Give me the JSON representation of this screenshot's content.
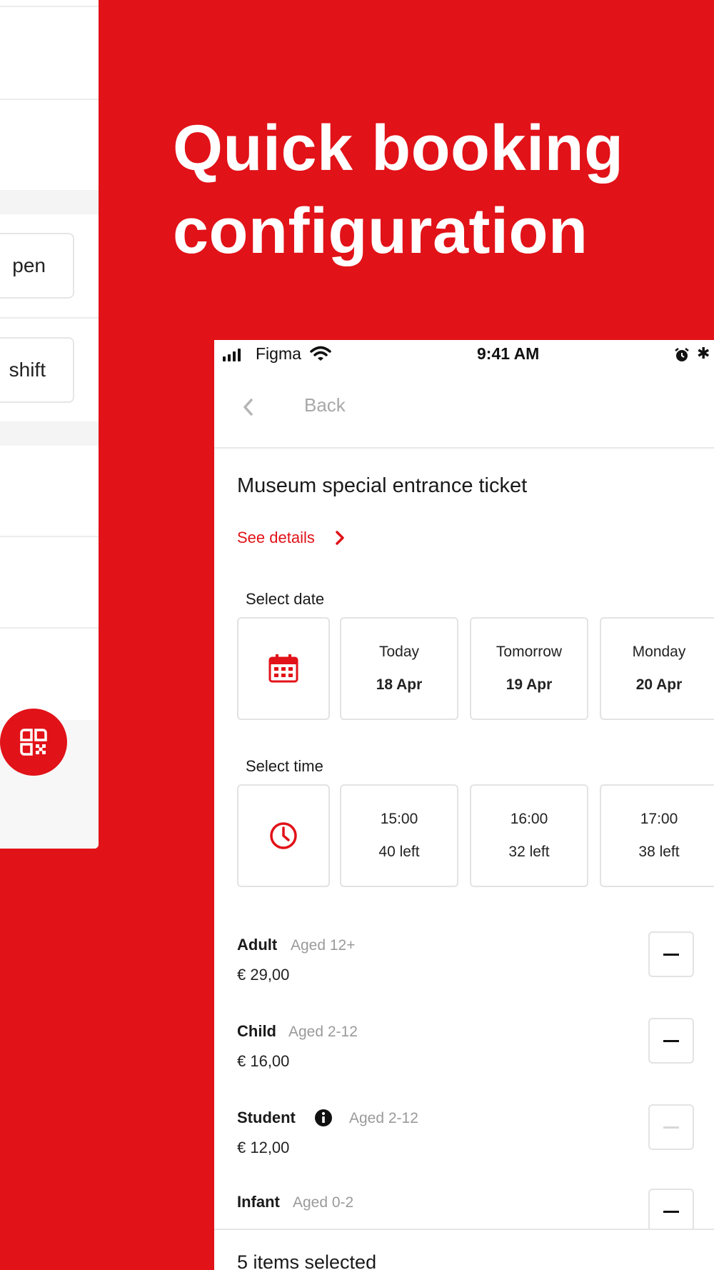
{
  "headline": {
    "line1": "Quick booking",
    "line2": "configuration"
  },
  "background_app": {
    "pill_1_label": "pen",
    "pill_2_label": "shift"
  },
  "status_bar": {
    "carrier": "Figma",
    "time": "9:41 AM"
  },
  "nav": {
    "back_label": "Back"
  },
  "ticket": {
    "title": "Museum special entrance ticket",
    "see_details": "See details"
  },
  "select_date": {
    "label": "Select date",
    "options": [
      {
        "day": "Today",
        "date": "18 Apr"
      },
      {
        "day": "Tomorrow",
        "date": "19 Apr"
      },
      {
        "day": "Monday",
        "date": "20 Apr"
      }
    ]
  },
  "select_time": {
    "label": "Select time",
    "options": [
      {
        "time": "15:00",
        "availability": "40 left"
      },
      {
        "time": "16:00",
        "availability": "32 left"
      },
      {
        "time": "17:00",
        "availability": "38 left"
      }
    ]
  },
  "price_types": [
    {
      "name": "Adult",
      "age": "Aged 12+",
      "price": "€ 29,00",
      "stepper_enabled": true
    },
    {
      "name": "Child",
      "age": "Aged 2-12",
      "price": "€ 16,00",
      "stepper_enabled": true
    },
    {
      "name": "Student",
      "age": "Aged 2-12",
      "price": "€ 12,00",
      "stepper_enabled": false
    },
    {
      "name": "Infant",
      "age": "Aged 0-2",
      "price": "",
      "stepper_enabled": true
    }
  ],
  "summary": {
    "label": "5 items selected"
  },
  "colors": {
    "brand_red": "#e11218",
    "text": "#1a1a1a",
    "muted": "#9a9a9a"
  }
}
